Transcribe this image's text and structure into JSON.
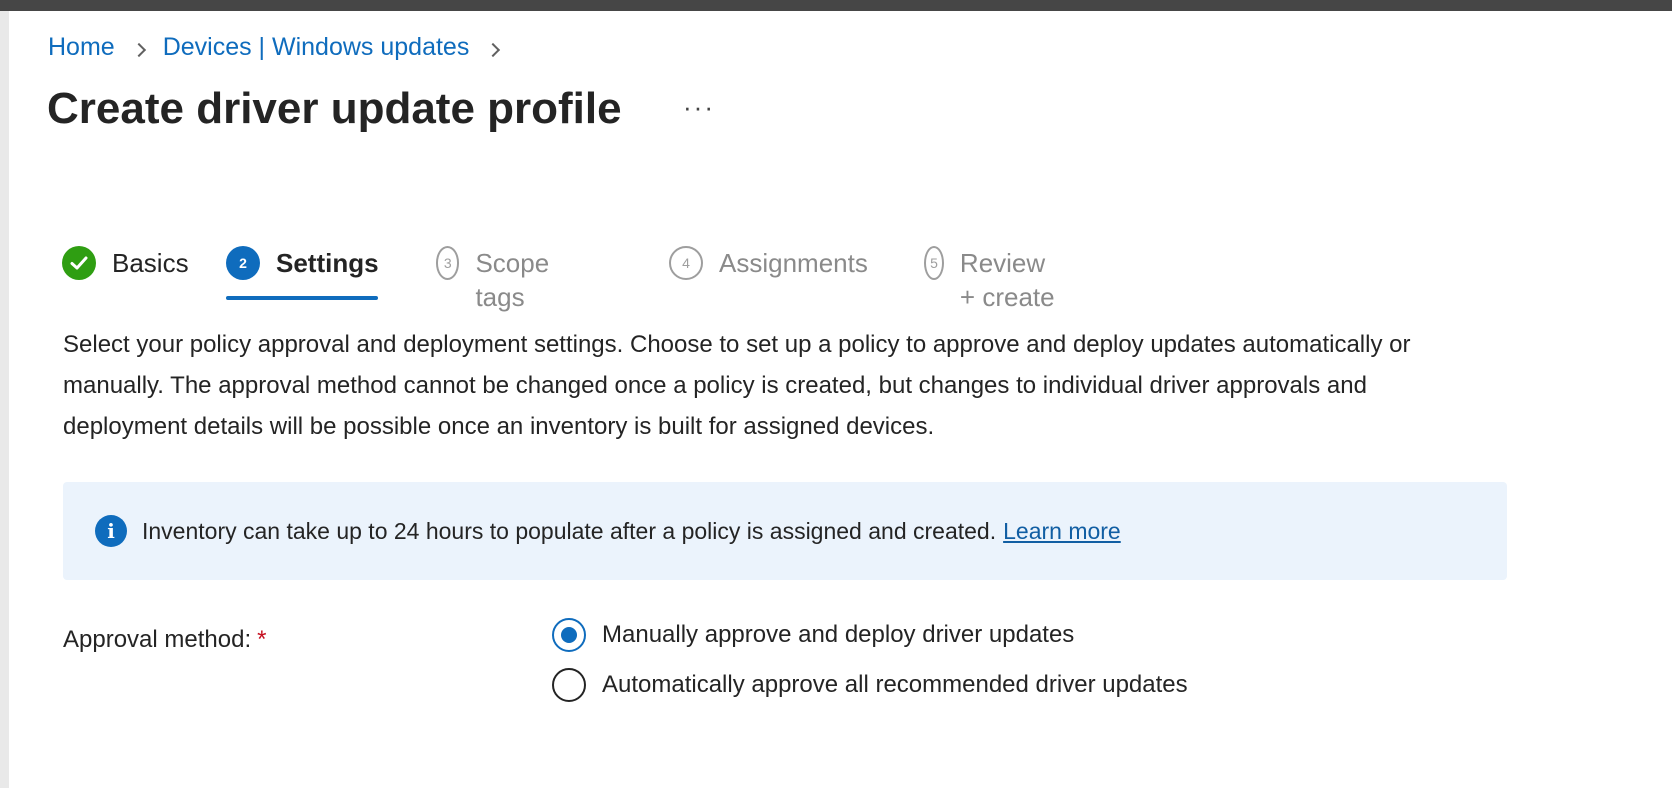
{
  "breadcrumb": {
    "home": "Home",
    "devices": "Devices | Windows updates"
  },
  "page": {
    "title": "Create driver update profile",
    "more": "···"
  },
  "steps": [
    {
      "number": "",
      "label": "Basics",
      "state": "done"
    },
    {
      "number": "2",
      "label": "Settings",
      "state": "active"
    },
    {
      "number": "3",
      "label": "Scope tags",
      "state": "future"
    },
    {
      "number": "4",
      "label": "Assignments",
      "state": "future"
    },
    {
      "number": "5",
      "label": "Review + create",
      "state": "future"
    }
  ],
  "description": "Select your policy approval and deployment settings. Choose to set up a policy to approve and deploy updates automatically or manually. The approval method cannot be changed once a policy is created, but changes to individual driver approvals and deployment details will be possible once an inventory is built for assigned devices.",
  "info": {
    "text": "Inventory can take up to 24 hours to populate after a policy is assigned and created.",
    "link": "Learn more"
  },
  "approval": {
    "label": "Approval method:",
    "required_mark": "*",
    "options": [
      {
        "label": "Manually approve and deploy driver updates",
        "checked": true
      },
      {
        "label": "Automatically approve all recommended driver updates",
        "checked": false
      }
    ]
  },
  "colors": {
    "accent": "#0f6cbd",
    "success": "#2f9e12",
    "info_bg": "#ebf3fc",
    "required": "#c50f1f"
  }
}
